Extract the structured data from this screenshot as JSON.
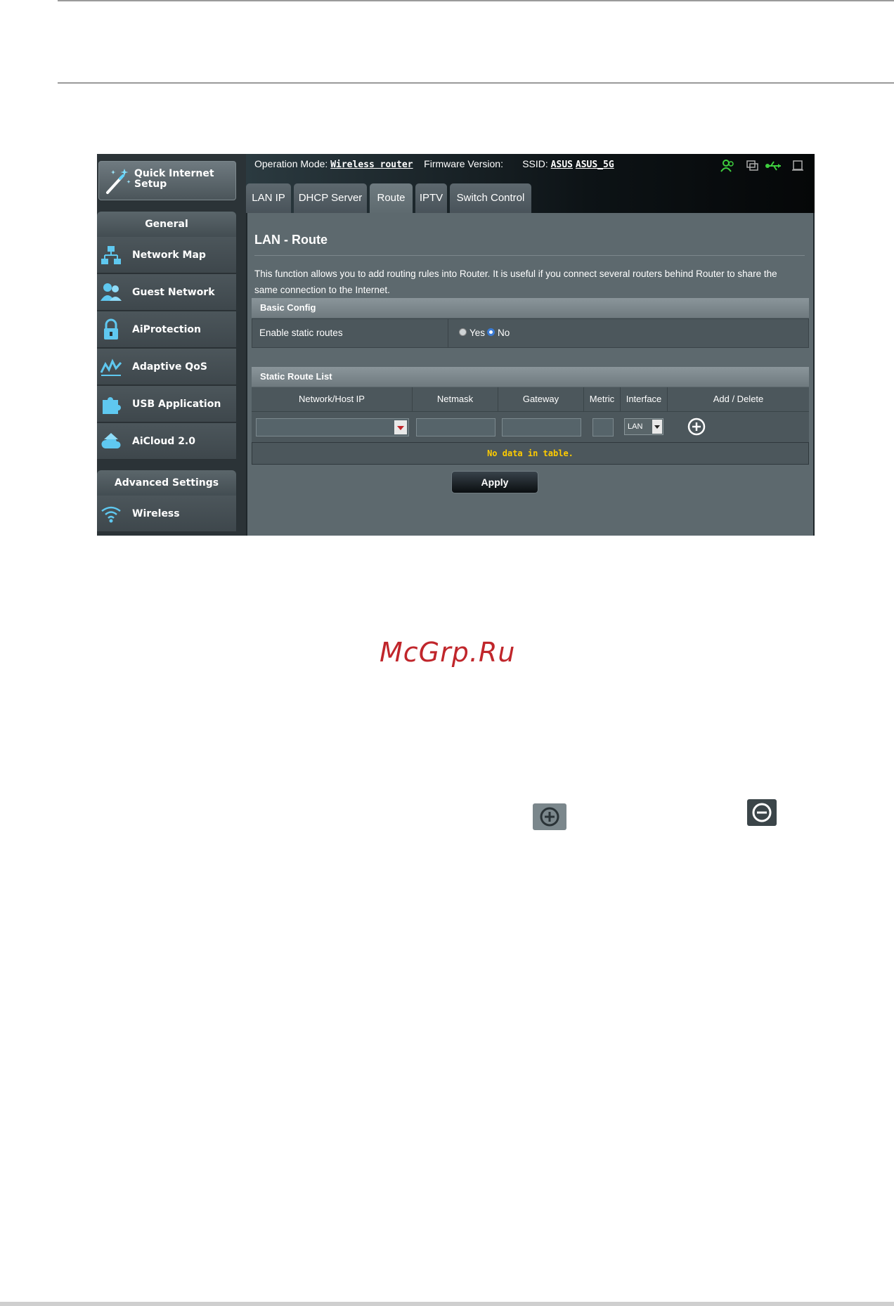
{
  "header": {
    "operation_mode_label": "Operation Mode:",
    "operation_mode_value": "Wireless router",
    "firmware_label": "Firmware Version:",
    "ssid_label": "SSID:",
    "ssid_1": "ASUS",
    "ssid_2": "ASUS_5G"
  },
  "sidebar": {
    "quick_setup": "Quick Internet Setup",
    "general_heading": "General",
    "items": [
      {
        "label": "Network Map",
        "icon": "network-map-icon"
      },
      {
        "label": "Guest Network",
        "icon": "guest-network-icon"
      },
      {
        "label": "AiProtection",
        "icon": "lock-icon"
      },
      {
        "label": "Adaptive QoS",
        "icon": "qos-chart-icon"
      },
      {
        "label": "USB Application",
        "icon": "puzzle-icon"
      },
      {
        "label": "AiCloud 2.0",
        "icon": "cloud-icon"
      }
    ],
    "advanced_heading": "Advanced Settings",
    "advanced_items": [
      {
        "label": "Wireless",
        "icon": "wifi-icon"
      }
    ]
  },
  "tabs": [
    {
      "label": "LAN IP",
      "active": false
    },
    {
      "label": "DHCP Server",
      "active": false
    },
    {
      "label": "Route",
      "active": true
    },
    {
      "label": "IPTV",
      "active": false
    },
    {
      "label": "Switch Control",
      "active": false
    }
  ],
  "page": {
    "title": "LAN - Route",
    "description": "This function allows you to add routing rules into Router. It is useful if you connect several routers behind Router to share the same connection to the Internet."
  },
  "basic_config": {
    "heading": "Basic Config",
    "enable_label": "Enable static routes",
    "yes_label": "Yes",
    "no_label": "No",
    "selected": "No"
  },
  "static_routes": {
    "heading": "Static Route List",
    "columns": [
      "Network/Host IP",
      "Netmask",
      "Gateway",
      "Metric",
      "Interface",
      "Add / Delete"
    ],
    "interface_value": "LAN",
    "empty_text": "No data in table."
  },
  "apply_label": "Apply",
  "watermark": "McGrp.Ru",
  "colors": {
    "accent_green": "#3ecf3e",
    "empty_text": "#ffcc00",
    "watermark": "#c0262b"
  }
}
